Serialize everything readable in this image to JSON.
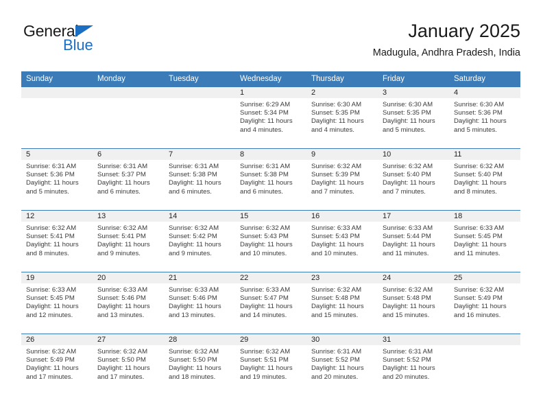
{
  "brand": {
    "name_part1": "General",
    "name_part2": "Blue",
    "accent_color": "#1b6ec2"
  },
  "header": {
    "title": "January 2025",
    "subtitle": "Madugula, Andhra Pradesh, India"
  },
  "calendar": {
    "header_color": "#3b7cb8",
    "weekday_headers": [
      "Sunday",
      "Monday",
      "Tuesday",
      "Wednesday",
      "Thursday",
      "Friday",
      "Saturday"
    ],
    "weeks": [
      [
        {
          "day": "",
          "blank": true
        },
        {
          "day": "",
          "blank": true
        },
        {
          "day": "",
          "blank": true
        },
        {
          "day": "1",
          "sunrise": "Sunrise: 6:29 AM",
          "sunset": "Sunset: 5:34 PM",
          "daylight_line1": "Daylight: 11 hours",
          "daylight_line2": "and 4 minutes."
        },
        {
          "day": "2",
          "sunrise": "Sunrise: 6:30 AM",
          "sunset": "Sunset: 5:35 PM",
          "daylight_line1": "Daylight: 11 hours",
          "daylight_line2": "and 4 minutes."
        },
        {
          "day": "3",
          "sunrise": "Sunrise: 6:30 AM",
          "sunset": "Sunset: 5:35 PM",
          "daylight_line1": "Daylight: 11 hours",
          "daylight_line2": "and 5 minutes."
        },
        {
          "day": "4",
          "sunrise": "Sunrise: 6:30 AM",
          "sunset": "Sunset: 5:36 PM",
          "daylight_line1": "Daylight: 11 hours",
          "daylight_line2": "and 5 minutes."
        }
      ],
      [
        {
          "day": "5",
          "sunrise": "Sunrise: 6:31 AM",
          "sunset": "Sunset: 5:36 PM",
          "daylight_line1": "Daylight: 11 hours",
          "daylight_line2": "and 5 minutes."
        },
        {
          "day": "6",
          "sunrise": "Sunrise: 6:31 AM",
          "sunset": "Sunset: 5:37 PM",
          "daylight_line1": "Daylight: 11 hours",
          "daylight_line2": "and 6 minutes."
        },
        {
          "day": "7",
          "sunrise": "Sunrise: 6:31 AM",
          "sunset": "Sunset: 5:38 PM",
          "daylight_line1": "Daylight: 11 hours",
          "daylight_line2": "and 6 minutes."
        },
        {
          "day": "8",
          "sunrise": "Sunrise: 6:31 AM",
          "sunset": "Sunset: 5:38 PM",
          "daylight_line1": "Daylight: 11 hours",
          "daylight_line2": "and 6 minutes."
        },
        {
          "day": "9",
          "sunrise": "Sunrise: 6:32 AM",
          "sunset": "Sunset: 5:39 PM",
          "daylight_line1": "Daylight: 11 hours",
          "daylight_line2": "and 7 minutes."
        },
        {
          "day": "10",
          "sunrise": "Sunrise: 6:32 AM",
          "sunset": "Sunset: 5:40 PM",
          "daylight_line1": "Daylight: 11 hours",
          "daylight_line2": "and 7 minutes."
        },
        {
          "day": "11",
          "sunrise": "Sunrise: 6:32 AM",
          "sunset": "Sunset: 5:40 PM",
          "daylight_line1": "Daylight: 11 hours",
          "daylight_line2": "and 8 minutes."
        }
      ],
      [
        {
          "day": "12",
          "sunrise": "Sunrise: 6:32 AM",
          "sunset": "Sunset: 5:41 PM",
          "daylight_line1": "Daylight: 11 hours",
          "daylight_line2": "and 8 minutes."
        },
        {
          "day": "13",
          "sunrise": "Sunrise: 6:32 AM",
          "sunset": "Sunset: 5:41 PM",
          "daylight_line1": "Daylight: 11 hours",
          "daylight_line2": "and 9 minutes."
        },
        {
          "day": "14",
          "sunrise": "Sunrise: 6:32 AM",
          "sunset": "Sunset: 5:42 PM",
          "daylight_line1": "Daylight: 11 hours",
          "daylight_line2": "and 9 minutes."
        },
        {
          "day": "15",
          "sunrise": "Sunrise: 6:32 AM",
          "sunset": "Sunset: 5:43 PM",
          "daylight_line1": "Daylight: 11 hours",
          "daylight_line2": "and 10 minutes."
        },
        {
          "day": "16",
          "sunrise": "Sunrise: 6:33 AM",
          "sunset": "Sunset: 5:43 PM",
          "daylight_line1": "Daylight: 11 hours",
          "daylight_line2": "and 10 minutes."
        },
        {
          "day": "17",
          "sunrise": "Sunrise: 6:33 AM",
          "sunset": "Sunset: 5:44 PM",
          "daylight_line1": "Daylight: 11 hours",
          "daylight_line2": "and 11 minutes."
        },
        {
          "day": "18",
          "sunrise": "Sunrise: 6:33 AM",
          "sunset": "Sunset: 5:45 PM",
          "daylight_line1": "Daylight: 11 hours",
          "daylight_line2": "and 11 minutes."
        }
      ],
      [
        {
          "day": "19",
          "sunrise": "Sunrise: 6:33 AM",
          "sunset": "Sunset: 5:45 PM",
          "daylight_line1": "Daylight: 11 hours",
          "daylight_line2": "and 12 minutes."
        },
        {
          "day": "20",
          "sunrise": "Sunrise: 6:33 AM",
          "sunset": "Sunset: 5:46 PM",
          "daylight_line1": "Daylight: 11 hours",
          "daylight_line2": "and 13 minutes."
        },
        {
          "day": "21",
          "sunrise": "Sunrise: 6:33 AM",
          "sunset": "Sunset: 5:46 PM",
          "daylight_line1": "Daylight: 11 hours",
          "daylight_line2": "and 13 minutes."
        },
        {
          "day": "22",
          "sunrise": "Sunrise: 6:33 AM",
          "sunset": "Sunset: 5:47 PM",
          "daylight_line1": "Daylight: 11 hours",
          "daylight_line2": "and 14 minutes."
        },
        {
          "day": "23",
          "sunrise": "Sunrise: 6:32 AM",
          "sunset": "Sunset: 5:48 PM",
          "daylight_line1": "Daylight: 11 hours",
          "daylight_line2": "and 15 minutes."
        },
        {
          "day": "24",
          "sunrise": "Sunrise: 6:32 AM",
          "sunset": "Sunset: 5:48 PM",
          "daylight_line1": "Daylight: 11 hours",
          "daylight_line2": "and 15 minutes."
        },
        {
          "day": "25",
          "sunrise": "Sunrise: 6:32 AM",
          "sunset": "Sunset: 5:49 PM",
          "daylight_line1": "Daylight: 11 hours",
          "daylight_line2": "and 16 minutes."
        }
      ],
      [
        {
          "day": "26",
          "sunrise": "Sunrise: 6:32 AM",
          "sunset": "Sunset: 5:49 PM",
          "daylight_line1": "Daylight: 11 hours",
          "daylight_line2": "and 17 minutes."
        },
        {
          "day": "27",
          "sunrise": "Sunrise: 6:32 AM",
          "sunset": "Sunset: 5:50 PM",
          "daylight_line1": "Daylight: 11 hours",
          "daylight_line2": "and 17 minutes."
        },
        {
          "day": "28",
          "sunrise": "Sunrise: 6:32 AM",
          "sunset": "Sunset: 5:50 PM",
          "daylight_line1": "Daylight: 11 hours",
          "daylight_line2": "and 18 minutes."
        },
        {
          "day": "29",
          "sunrise": "Sunrise: 6:32 AM",
          "sunset": "Sunset: 5:51 PM",
          "daylight_line1": "Daylight: 11 hours",
          "daylight_line2": "and 19 minutes."
        },
        {
          "day": "30",
          "sunrise": "Sunrise: 6:31 AM",
          "sunset": "Sunset: 5:52 PM",
          "daylight_line1": "Daylight: 11 hours",
          "daylight_line2": "and 20 minutes."
        },
        {
          "day": "31",
          "sunrise": "Sunrise: 6:31 AM",
          "sunset": "Sunset: 5:52 PM",
          "daylight_line1": "Daylight: 11 hours",
          "daylight_line2": "and 20 minutes."
        },
        {
          "day": "",
          "blank": true
        }
      ]
    ]
  }
}
